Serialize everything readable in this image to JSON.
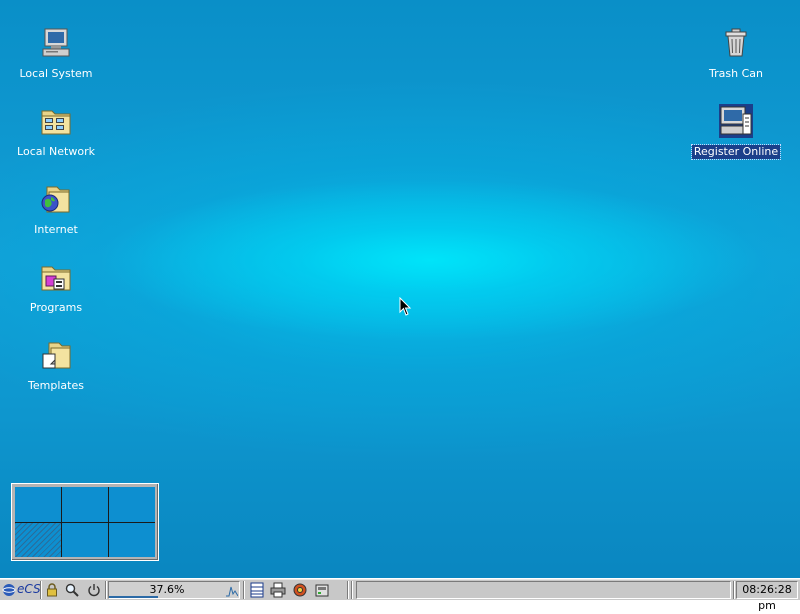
{
  "desktop": {
    "icons_left": [
      {
        "label": "Local System",
        "icon": "computer-icon"
      },
      {
        "label": "Local Network",
        "icon": "network-folder-icon"
      },
      {
        "label": "Internet",
        "icon": "internet-folder-icon"
      },
      {
        "label": "Programs",
        "icon": "programs-folder-icon"
      },
      {
        "label": "Templates",
        "icon": "templates-folder-icon"
      }
    ],
    "icons_right": [
      {
        "label": "Trash Can",
        "icon": "trash-can-icon"
      },
      {
        "label": "Register Online",
        "icon": "register-online-icon",
        "selected": true
      }
    ],
    "pager": {
      "columns": 3,
      "rows": 2,
      "active_index": 3
    }
  },
  "taskbar": {
    "start_label": "eCS",
    "icons": [
      "lock-icon",
      "search-icon",
      "power-icon"
    ],
    "cpu_load": "37.6%",
    "cpu_fraction": 0.376,
    "tray_icons": [
      "window-list-icon",
      "printer-icon",
      "settings-icon",
      "drives-icon"
    ],
    "clock": "08:26:28 pm"
  }
}
